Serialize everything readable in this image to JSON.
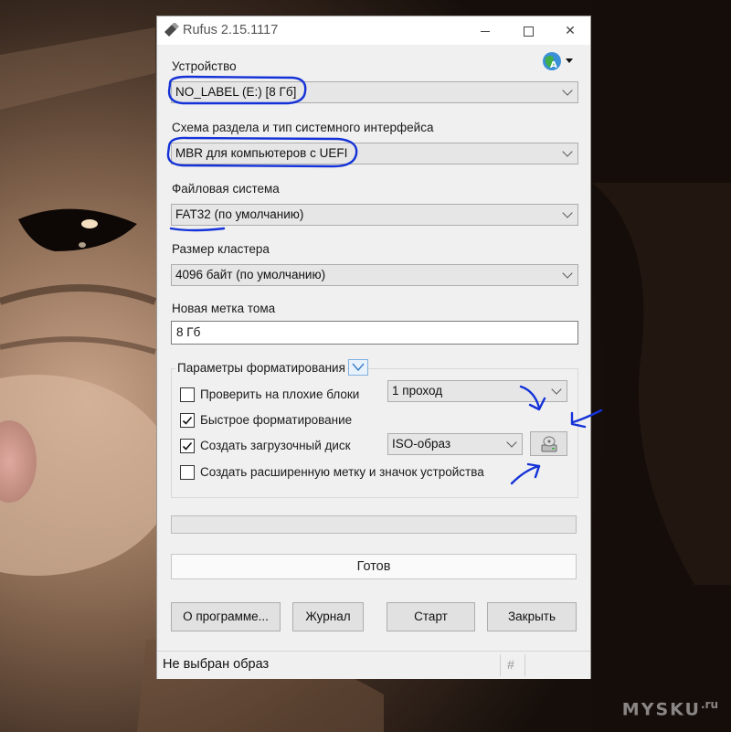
{
  "window": {
    "title": "Rufus 2.15.1117",
    "min_label": "",
    "close_label": "✕"
  },
  "device": {
    "label": "Устройство",
    "value": "NO_LABEL (E:) [8 Гб]"
  },
  "partition": {
    "label": "Схема раздела и тип системного интерфейса",
    "value": "MBR для компьютеров с UEFI"
  },
  "filesystem": {
    "label": "Файловая система",
    "value": "FAT32 (по умолчанию)"
  },
  "cluster": {
    "label": "Размер кластера",
    "value": "4096 байт (по умолчанию)"
  },
  "volume": {
    "label": "Новая метка тома",
    "value": "8 Гб"
  },
  "format_options": {
    "title": "Параметры форматирования",
    "bad_blocks": {
      "label": "Проверить на плохие блоки",
      "checked": false
    },
    "passes": "1 проход",
    "quick_format": {
      "label": "Быстрое форматирование",
      "checked": true
    },
    "bootable": {
      "label": "Создать загрузочный диск",
      "checked": true
    },
    "image_type": "ISO-образ",
    "extended_label": {
      "label": "Создать расширенную метку и значок устройства",
      "checked": false
    }
  },
  "progress": {
    "value": 0
  },
  "status": "Готов",
  "buttons": {
    "about": "О программе...",
    "log": "Журнал",
    "start": "Старт",
    "close": "Закрыть"
  },
  "statusbar": {
    "text": "Не выбран образ",
    "hash": "#"
  },
  "watermark": {
    "text": "MYSKU",
    "sup": ".ru"
  },
  "colors": {
    "annotation": "#1432d8",
    "accent": "#7fb0e0"
  },
  "icons": [
    "usb-drive-icon",
    "language-globe-icon",
    "chevron-down-icon",
    "checkmark-icon",
    "disc-drive-icon"
  ]
}
